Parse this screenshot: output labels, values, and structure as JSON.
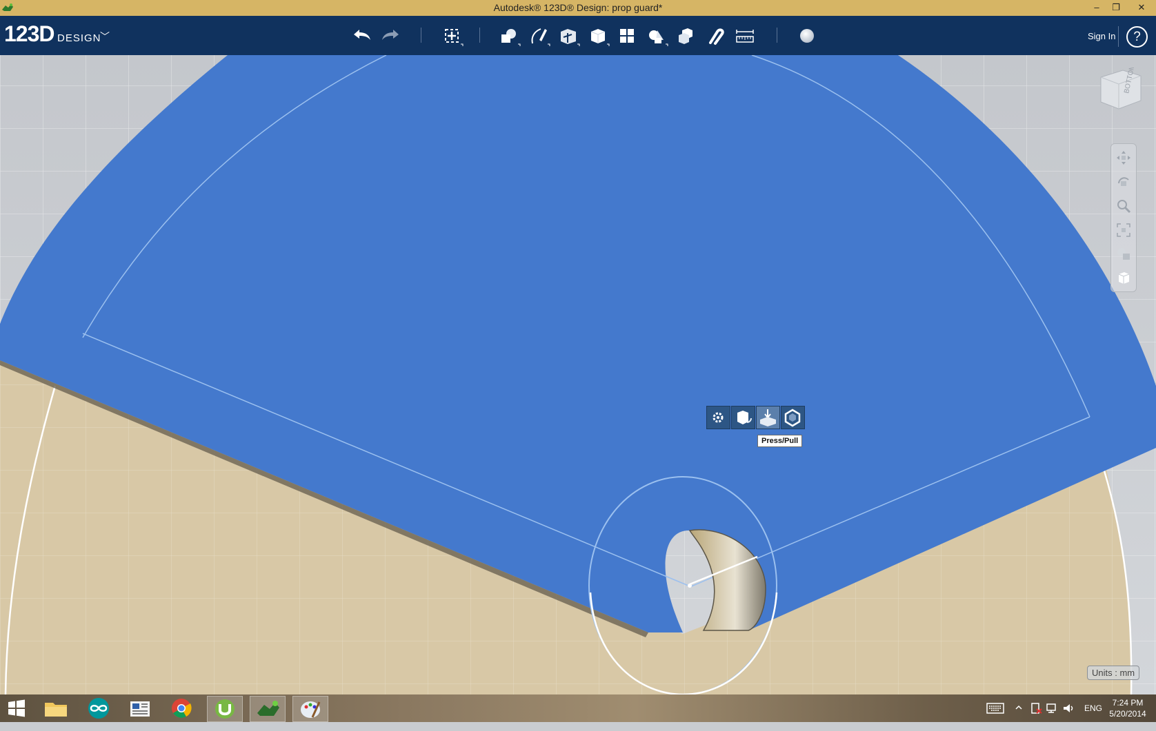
{
  "window": {
    "title": "Autodesk® 123D® Design: prop guard*",
    "minimize": "–",
    "restore": "❐",
    "close": "✕"
  },
  "app": {
    "logo_main": "123D",
    "logo_sub": "DESIGN",
    "logo_chevron": "﹀",
    "sign_in": "Sign In",
    "help": "?"
  },
  "toolbar": {
    "tools": [
      "undo-icon",
      "redo-icon",
      "transform-icon",
      "primitives-icon",
      "sketch-icon",
      "construct-icon",
      "modify-icon",
      "pattern-icon",
      "group-icon",
      "combine-icon",
      "snap-icon",
      "measure-icon",
      "material-icon"
    ]
  },
  "viewcube": {
    "face_label": "BOTTOM"
  },
  "context_menu": {
    "items": [
      "settings-icon",
      "tweak-icon",
      "press-pull-icon",
      "shell-icon"
    ],
    "tooltip": "Press/Pull"
  },
  "status": {
    "units": "Units : mm"
  },
  "taskbar": {
    "apps": [
      "windows-start",
      "file-explorer",
      "arduino",
      "news-app",
      "chrome",
      "utorrent",
      "123d-design",
      "paint"
    ],
    "language": "ENG",
    "time": "7:24 PM",
    "date": "5/20/2014"
  },
  "colors": {
    "toolbar": "#10325e",
    "titlebar": "#d6b565",
    "model_blue": "#4479cd",
    "ground_plane": "#d8c8a6"
  }
}
